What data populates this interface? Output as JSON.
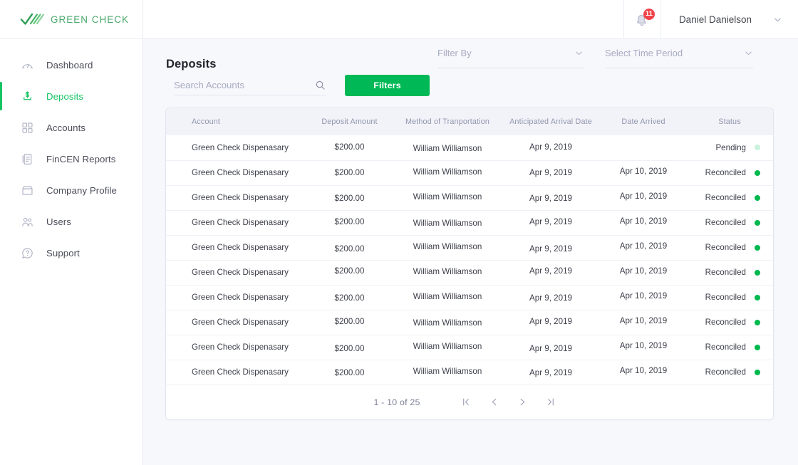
{
  "brand": {
    "name": "GREEN CHECK",
    "logo_icon": "green-check-logo",
    "accent": "#4aa96c"
  },
  "sidebar": {
    "items": [
      {
        "label": "Dashboard",
        "icon": "gauge-icon",
        "active": false
      },
      {
        "label": "Deposits",
        "icon": "dollar-icon",
        "active": true
      },
      {
        "label": "Accounts",
        "icon": "grid-icon",
        "active": false
      },
      {
        "label": "FinCEN Reports",
        "icon": "document-icon",
        "active": false
      },
      {
        "label": "Company Profile",
        "icon": "store-icon",
        "active": false
      },
      {
        "label": "Users",
        "icon": "users-icon",
        "active": false
      },
      {
        "label": "Support",
        "icon": "help-icon",
        "active": false
      }
    ],
    "active_color": "#17c464"
  },
  "topbar": {
    "notifications": {
      "icon": "bell-icon",
      "count": "11",
      "badge_color": "#f0444a"
    },
    "user": {
      "name": "Daniel Danielson",
      "caret_icon": "chevron-down-icon"
    }
  },
  "page": {
    "title": "Deposits",
    "filter_by": {
      "label": "Filter By",
      "caret_icon": "chevron-down-icon"
    },
    "time_period": {
      "label": "Select Time Period",
      "caret_icon": "chevron-down-icon"
    },
    "search": {
      "value": "",
      "placeholder": "Search Accounts",
      "icon": "search-icon"
    },
    "filters_button": {
      "label": "Filters",
      "color": "#00b956"
    }
  },
  "table": {
    "columns": [
      "Account",
      "Deposit Amount",
      "Method of Tranportation",
      "Anticipated Arrival Date",
      "Date Arrived",
      "Status"
    ],
    "rows": [
      {
        "account": "Green Check Dispenasary",
        "amount": "$200.00",
        "method": "William Williamson",
        "anticipated": "Apr 9, 2019",
        "arrived": "",
        "status": "Pending",
        "status_color": "#c9f2dc"
      },
      {
        "account": "Green Check Dispenasary",
        "amount": "$200.00",
        "method": "William Williamson",
        "anticipated": "Apr 9, 2019",
        "arrived": "Apr 10, 2019",
        "status": "Reconciled",
        "status_color": "#00b94e"
      },
      {
        "account": "Green Check Dispenasary",
        "amount": "$200.00",
        "method": "William Williamson",
        "anticipated": "Apr 9, 2019",
        "arrived": "Apr 10, 2019",
        "status": "Reconciled",
        "status_color": "#00b94e"
      },
      {
        "account": "Green Check Dispenasary",
        "amount": "$200.00",
        "method": "William Williamson",
        "anticipated": "Apr 9, 2019",
        "arrived": "Apr 10, 2019",
        "status": "Reconciled",
        "status_color": "#00b94e"
      },
      {
        "account": "Green Check Dispenasary",
        "amount": "$200.00",
        "method": "William Williamson",
        "anticipated": "Apr 9, 2019",
        "arrived": "Apr 10, 2019",
        "status": "Reconciled",
        "status_color": "#00b94e"
      },
      {
        "account": "Green Check Dispenasary",
        "amount": "$200.00",
        "method": "William Williamson",
        "anticipated": "Apr 9, 2019",
        "arrived": "Apr 10, 2019",
        "status": "Reconciled",
        "status_color": "#00b94e"
      },
      {
        "account": "Green Check Dispenasary",
        "amount": "$200.00",
        "method": "William Williamson",
        "anticipated": "Apr 9, 2019",
        "arrived": "Apr 10, 2019",
        "status": "Reconciled",
        "status_color": "#00b94e"
      },
      {
        "account": "Green Check Dispenasary",
        "amount": "$200.00",
        "method": "William Williamson",
        "anticipated": "Apr 9, 2019",
        "arrived": "Apr 10, 2019",
        "status": "Reconciled",
        "status_color": "#00b94e"
      },
      {
        "account": "Green Check Dispenasary",
        "amount": "$200.00",
        "method": "William Williamson",
        "anticipated": "Apr 9, 2019",
        "arrived": "Apr 10, 2019",
        "status": "Reconciled",
        "status_color": "#00b94e"
      },
      {
        "account": "Green Check Dispenasary",
        "amount": "$200.00",
        "method": "William Williamson",
        "anticipated": "Apr 9, 2019",
        "arrived": "Apr 10, 2019",
        "status": "Reconciled",
        "status_color": "#00b94e"
      }
    ]
  },
  "pagination": {
    "range_text": "1 - 10 of 25",
    "first_label": "|<",
    "prev_label": "‹",
    "next_label": "›",
    "last_label": ">|"
  }
}
